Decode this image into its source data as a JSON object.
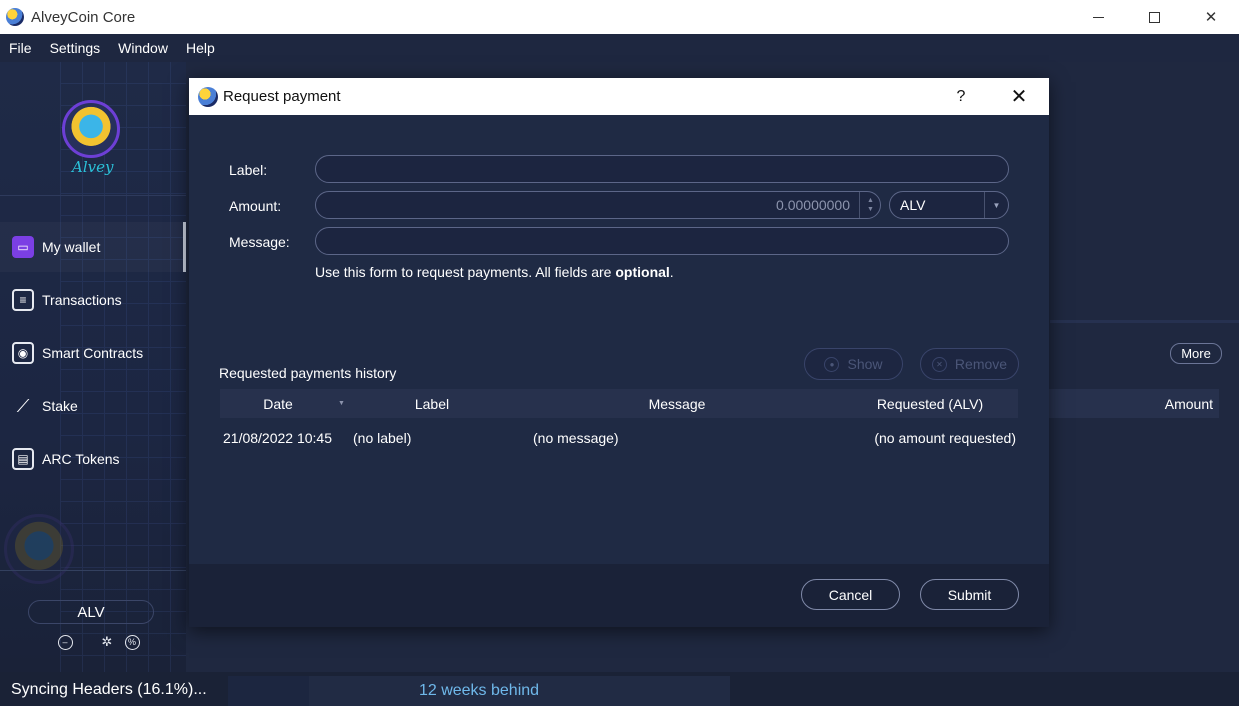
{
  "window": {
    "title": "AlveyCoin Core",
    "controls": {
      "minimize": "minimize",
      "maximize": "maximize",
      "close": "✕"
    }
  },
  "menu": [
    {
      "label": "File"
    },
    {
      "label": "Settings"
    },
    {
      "label": "Window"
    },
    {
      "label": "Help"
    }
  ],
  "sidebar": {
    "logo_text": "Alvey",
    "items": [
      {
        "label": "My wallet",
        "icon": "wallet-icon",
        "active": true
      },
      {
        "label": "Transactions",
        "icon": "list-icon",
        "active": false
      },
      {
        "label": "Smart Contracts",
        "icon": "contract-icon",
        "active": false
      },
      {
        "label": "Stake",
        "icon": "stake-icon",
        "active": false
      },
      {
        "label": "ARC Tokens",
        "icon": "tokens-icon",
        "active": false
      }
    ],
    "unit": "ALV",
    "tray_icons": [
      "sync-icon",
      "network-icon",
      "staking-icon"
    ]
  },
  "background": {
    "more_label": "More",
    "amount_header": "Amount"
  },
  "dialog": {
    "title": "Request payment",
    "help": "?",
    "close": "✕",
    "form": {
      "label_label": "Label:",
      "label_value": "",
      "amount_label": "Amount:",
      "amount_value": "0.00000000",
      "unit_value": "ALV",
      "message_label": "Message:",
      "message_value": "",
      "hint_prefix": "Use this form to request payments. All fields are ",
      "hint_bold": "optional",
      "hint_suffix": "."
    },
    "history": {
      "title": "Requested payments history",
      "show_label": "Show",
      "remove_label": "Remove",
      "columns": [
        "Date",
        "Label",
        "Message",
        "Requested (ALV)"
      ],
      "rows": [
        {
          "date": "21/08/2022 10:45",
          "label": "(no label)",
          "message": "(no message)",
          "amount": "(no amount requested)"
        }
      ]
    },
    "footer": {
      "cancel_label": "Cancel",
      "submit_label": "Submit"
    }
  },
  "status": {
    "sync_text": "Syncing Headers (16.1%)...",
    "progress_text": "12 weeks behind",
    "progress_fraction": 0.161
  }
}
